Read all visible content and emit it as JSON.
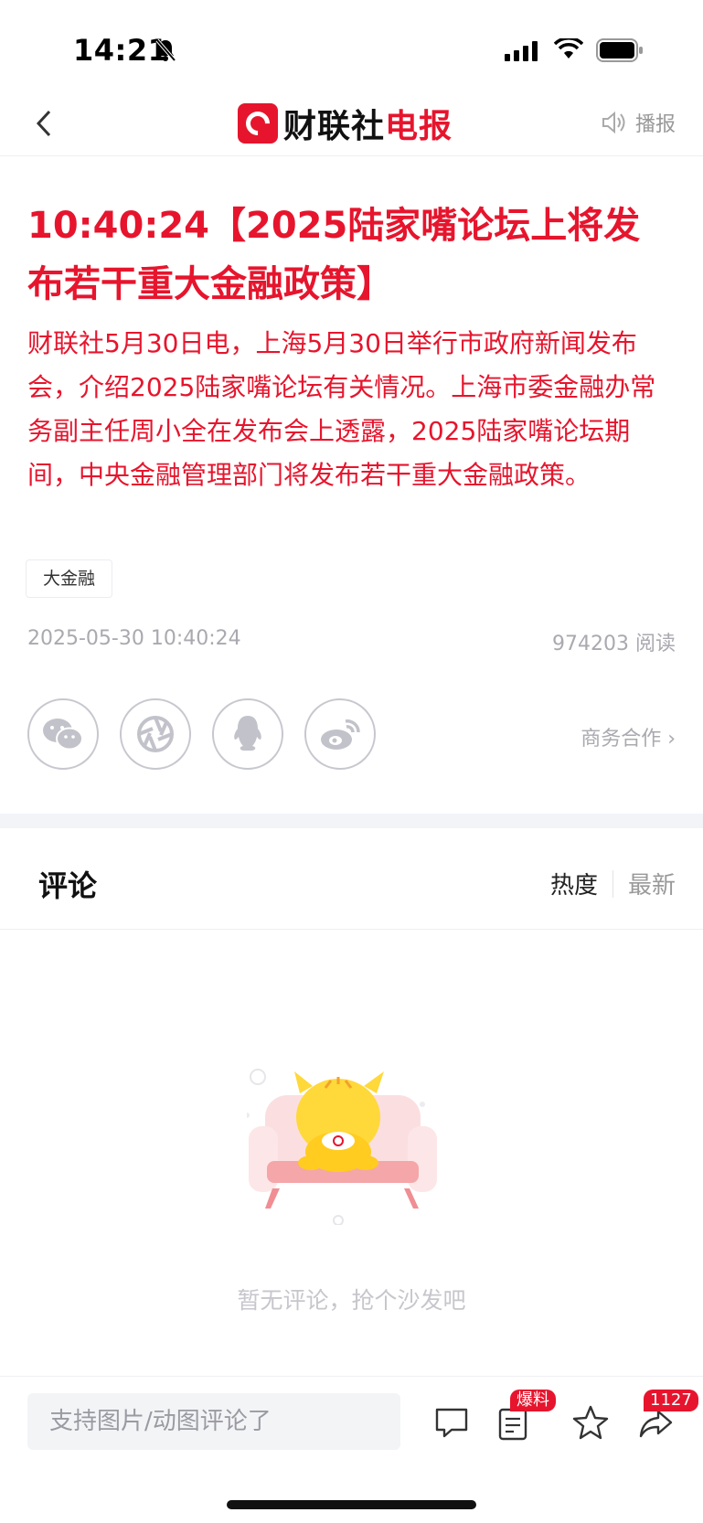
{
  "status": {
    "time": "14:21"
  },
  "nav": {
    "brand_a": "财联社",
    "brand_b": "电报",
    "broadcast_label": "播报"
  },
  "article": {
    "headline": "10:40:24【2025陆家嘴论坛上将发布若干重大金融政策】",
    "body": "财联社5月30日电，上海5月30日举行市政府新闻发布会，介绍2025陆家嘴论坛有关情况。上海市委金融办常务副主任周小全在发布会上透露，2025陆家嘴论坛期间，中央金融管理部门将发布若干重大金融政策。",
    "tag": "大金融",
    "date": "2025-05-30 10:40:24",
    "reads": "974203 阅读"
  },
  "share": {
    "icons": [
      "wechat-icon",
      "moments-icon",
      "qq-icon",
      "weibo-icon"
    ],
    "business_label": "商务合作 ›"
  },
  "comments": {
    "title": "评论",
    "sort_hot": "热度",
    "sort_new": "最新",
    "empty_text": "暂无评论，抢个沙发吧"
  },
  "bottom_bar": {
    "input_placeholder": "支持图片/动图评论了",
    "report_badge": "爆料",
    "share_count": "1127"
  },
  "colors": {
    "accent": "#e6152d",
    "muted": "#a9a9b0"
  }
}
